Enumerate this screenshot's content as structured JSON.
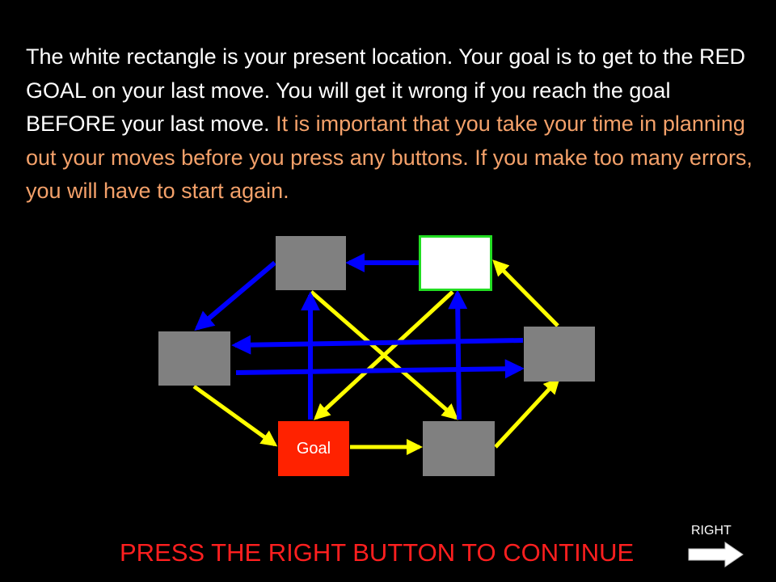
{
  "instructions": {
    "normal": "The white rectangle is your present location. Your goal is to get to the RED GOAL on your last move. You will get it wrong if you reach the goal BEFORE your last move.",
    "warning": "It is important that you take your time in planning out your moves before you press any buttons. If you make too many errors, you will have to start again."
  },
  "board": {
    "goal_label": "Goal",
    "colors": {
      "blue_arrow": "#0000ff",
      "yellow_arrow": "#ffff00",
      "grey_node": "#808080",
      "current_node": "#ffffff",
      "current_border": "#22dd22",
      "goal_node": "#ff2200"
    }
  },
  "footer": {
    "prompt": "PRESS THE RIGHT BUTTON TO CONTINUE",
    "right_label": "RIGHT",
    "arrow_icon": "right-arrow-icon"
  }
}
